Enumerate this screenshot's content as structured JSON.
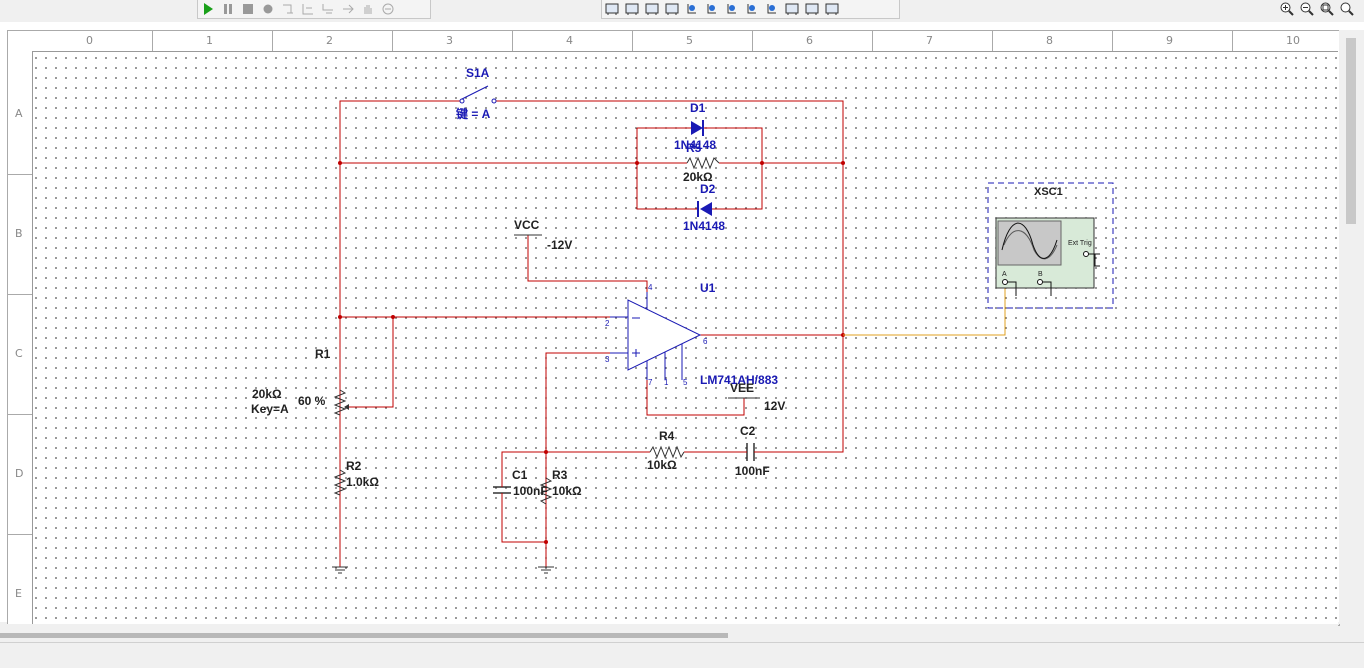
{
  "toolbar": {
    "sim_buttons": [
      "play-icon",
      "pause-icon",
      "stop-icon",
      "probe-icon",
      "step-icon",
      "step-into-icon",
      "step-over-icon",
      "step-out-icon",
      "hand-icon",
      "breakpoint-icon"
    ],
    "instrument_buttons": [
      "instrument-1",
      "instrument-2",
      "instrument-3",
      "instrument-4",
      "instrument-5",
      "instrument-6",
      "instrument-7",
      "instrument-8",
      "instrument-9",
      "instrument-10",
      "instrument-11",
      "instrument-12"
    ],
    "zoom_buttons": [
      "zoom-in-icon",
      "zoom-out-icon",
      "zoom-area-icon",
      "zoom-fit-icon"
    ]
  },
  "ruler": {
    "columns": [
      "0",
      "1",
      "2",
      "3",
      "4",
      "5",
      "6",
      "7",
      "8",
      "9",
      "10"
    ],
    "rows": [
      "A",
      "B",
      "C",
      "D",
      "E"
    ]
  },
  "colors": {
    "wire": "#c00000",
    "component": "#1a1ab4",
    "label": "#1a1ab4",
    "probe_wire": "#e0a020"
  },
  "components": {
    "s1a": {
      "name": "S1A",
      "key": "键 = A"
    },
    "d1": {
      "name": "D1",
      "model": "1N4148"
    },
    "d2": {
      "name": "D2",
      "model": "1N4148"
    },
    "r5": {
      "name": "R5",
      "value": "20kΩ"
    },
    "vcc": {
      "name": "VCC",
      "value": "-12V"
    },
    "vee": {
      "name": "VEE",
      "value": "12V"
    },
    "u1": {
      "name": "U1",
      "model": "LM741AH/883",
      "pins": {
        "p2": "2",
        "p3": "3",
        "p4": "4",
        "p6": "6",
        "p7": "7",
        "p1": "1",
        "p5": "5"
      }
    },
    "r1": {
      "name": "R1",
      "value": "20kΩ",
      "key": "Key=A",
      "setting": "60 %"
    },
    "r2": {
      "name": "R2",
      "value": "1.0kΩ"
    },
    "r3": {
      "name": "R3",
      "value": "10kΩ"
    },
    "r4": {
      "name": "R4",
      "value": "10kΩ"
    },
    "c1": {
      "name": "C1",
      "value": "100nF"
    },
    "c2": {
      "name": "C2",
      "value": "100nF"
    },
    "xsc1": {
      "name": "XSC1",
      "ext_trig": "Ext Trig",
      "ch_a": "A",
      "ch_b": "B"
    }
  }
}
